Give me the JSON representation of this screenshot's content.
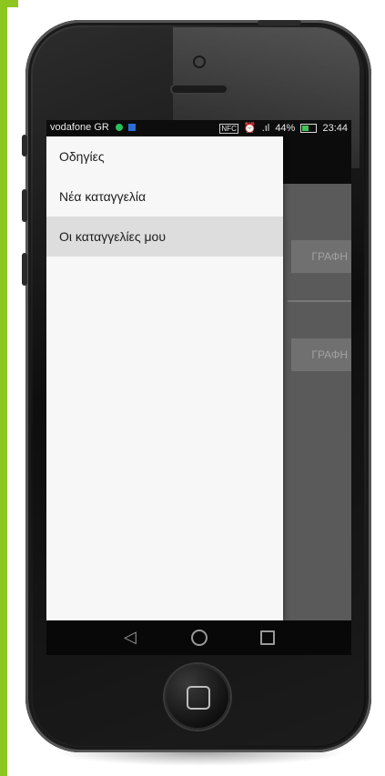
{
  "status_bar": {
    "carrier": "vodafone GR",
    "nfc": "NFC",
    "signal": ".ıl",
    "battery_percent": "44%",
    "time": "23:44"
  },
  "drawer": {
    "items": [
      {
        "label": "Οδηγίες",
        "active": false
      },
      {
        "label": "Νέα καταγγελία",
        "active": false
      },
      {
        "label": "Οι καταγγελίες μου",
        "active": true
      }
    ]
  },
  "background_app": {
    "button_1": "ΓΡΑΦΗ",
    "button_2": "ΓΡΑΦΗ"
  },
  "nav": {
    "back_glyph": "◁"
  },
  "colors": {
    "accent_border": "#8cc61f",
    "drawer_bg": "#f7f7f7",
    "active_item_bg": "#dddddd"
  }
}
